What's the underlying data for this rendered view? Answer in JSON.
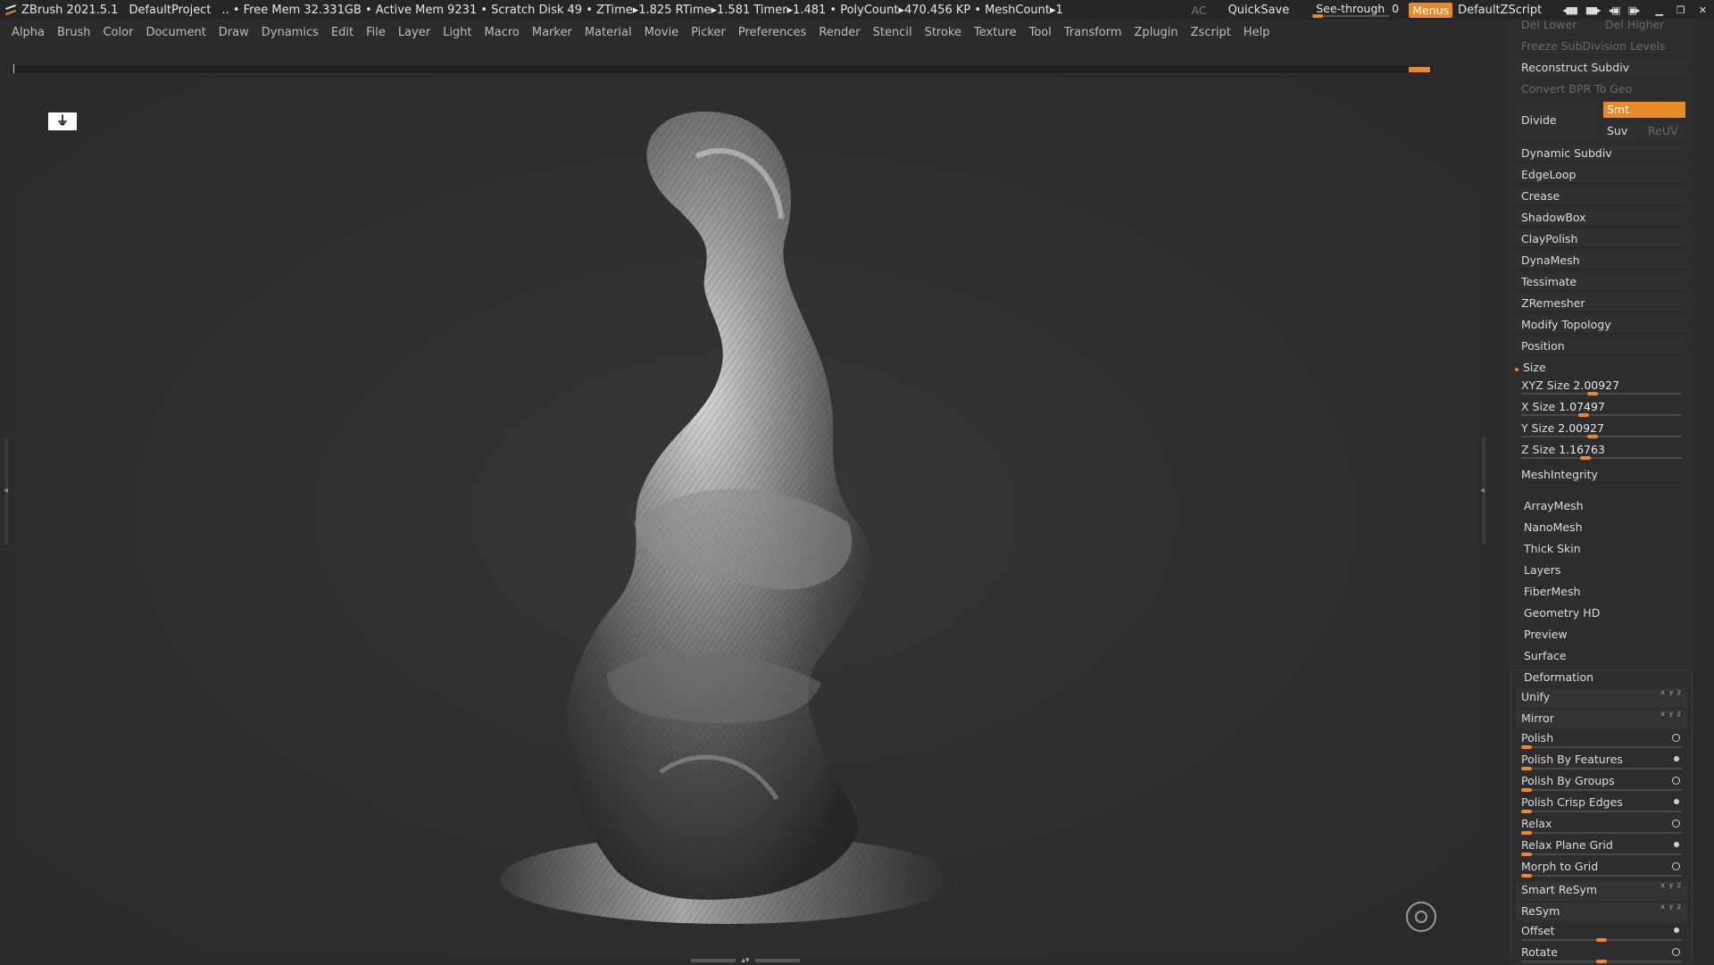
{
  "titlebar": {
    "app": "ZBrush 2021.5.1",
    "project": "DefaultProject",
    "stats": ".. • Free Mem 32.331GB • Active Mem 9231 • Scratch Disk 49 •  ZTime▸1.825 RTime▸1.581 Timer▸1.481 • PolyCount▸470.456 KP  • MeshCount▸1",
    "ac": "AC",
    "quicksave": "QuickSave",
    "see_through_label": "See-through",
    "see_through_value": "0",
    "see_through_level": 0,
    "menus": "Menus",
    "zscript": "DefaultZScript"
  },
  "menubar": [
    "Alpha",
    "Brush",
    "Color",
    "Document",
    "Draw",
    "Dynamics",
    "Edit",
    "File",
    "Layer",
    "Light",
    "Macro",
    "Marker",
    "Material",
    "Movie",
    "Picker",
    "Preferences",
    "Render",
    "Stencil",
    "Stroke",
    "Texture",
    "Tool",
    "Transform",
    "Zplugin",
    "Zscript",
    "Help"
  ],
  "panel": {
    "del_lower": "Del Lower",
    "del_higher": "Del Higher",
    "freeze": "Freeze SubDivision Levels",
    "reconstruct": "Reconstruct Subdiv",
    "convert_bpr": "Convert BPR To Geo",
    "divide": "Divide",
    "smt": "Smt",
    "suv": "Suv",
    "reuv": "ReUV",
    "geometry_items": [
      "Dynamic Subdiv",
      "EdgeLoop",
      "Crease",
      "ShadowBox",
      "ClayPolish",
      "DynaMesh",
      "Tessimate",
      "ZRemesher",
      "Modify Topology",
      "Position"
    ],
    "size_header": "Size",
    "size_sliders": [
      {
        "label": "XYZ Size",
        "value": "2.00927",
        "level": 0.44
      },
      {
        "label": "X Size",
        "value": "1.07497",
        "level": 0.38
      },
      {
        "label": "Y Size",
        "value": "2.00927",
        "level": 0.44
      },
      {
        "label": "Z Size",
        "value": "1.16763",
        "level": 0.39
      }
    ],
    "mesh_integrity": "MeshIntegrity",
    "subpalettes": [
      "ArrayMesh",
      "NanoMesh",
      "Thick Skin",
      "Layers",
      "FiberMesh",
      "Geometry HD",
      "Preview",
      "Surface"
    ],
    "deformation_header": "Deformation",
    "deformation": [
      {
        "label": "Unify",
        "type": "button"
      },
      {
        "label": "Mirror",
        "type": "button"
      },
      {
        "label": "Polish",
        "type": "slider",
        "level": 0.0
      },
      {
        "label": "Polish By Features",
        "type": "slider",
        "level": 0.0
      },
      {
        "label": "Polish By Groups",
        "type": "slider",
        "level": 0.0
      },
      {
        "label": "Polish Crisp Edges",
        "type": "slider",
        "level": 0.0
      },
      {
        "label": "Relax",
        "type": "slider",
        "level": 0.0
      },
      {
        "label": "Relax Plane Grid",
        "type": "slider",
        "level": 0.0
      },
      {
        "label": "Morph to Grid",
        "type": "slider",
        "level": 0.0
      },
      {
        "label": "Smart ReSym",
        "type": "button"
      },
      {
        "label": "ReSym",
        "type": "button"
      },
      {
        "label": "Offset",
        "type": "slider",
        "level": 0.5
      },
      {
        "label": "Rotate",
        "type": "slider",
        "level": 0.5
      }
    ]
  },
  "colors": {
    "accent": "#e8892a",
    "background": "#2b2b2b",
    "panel": "#2d2d2d"
  }
}
